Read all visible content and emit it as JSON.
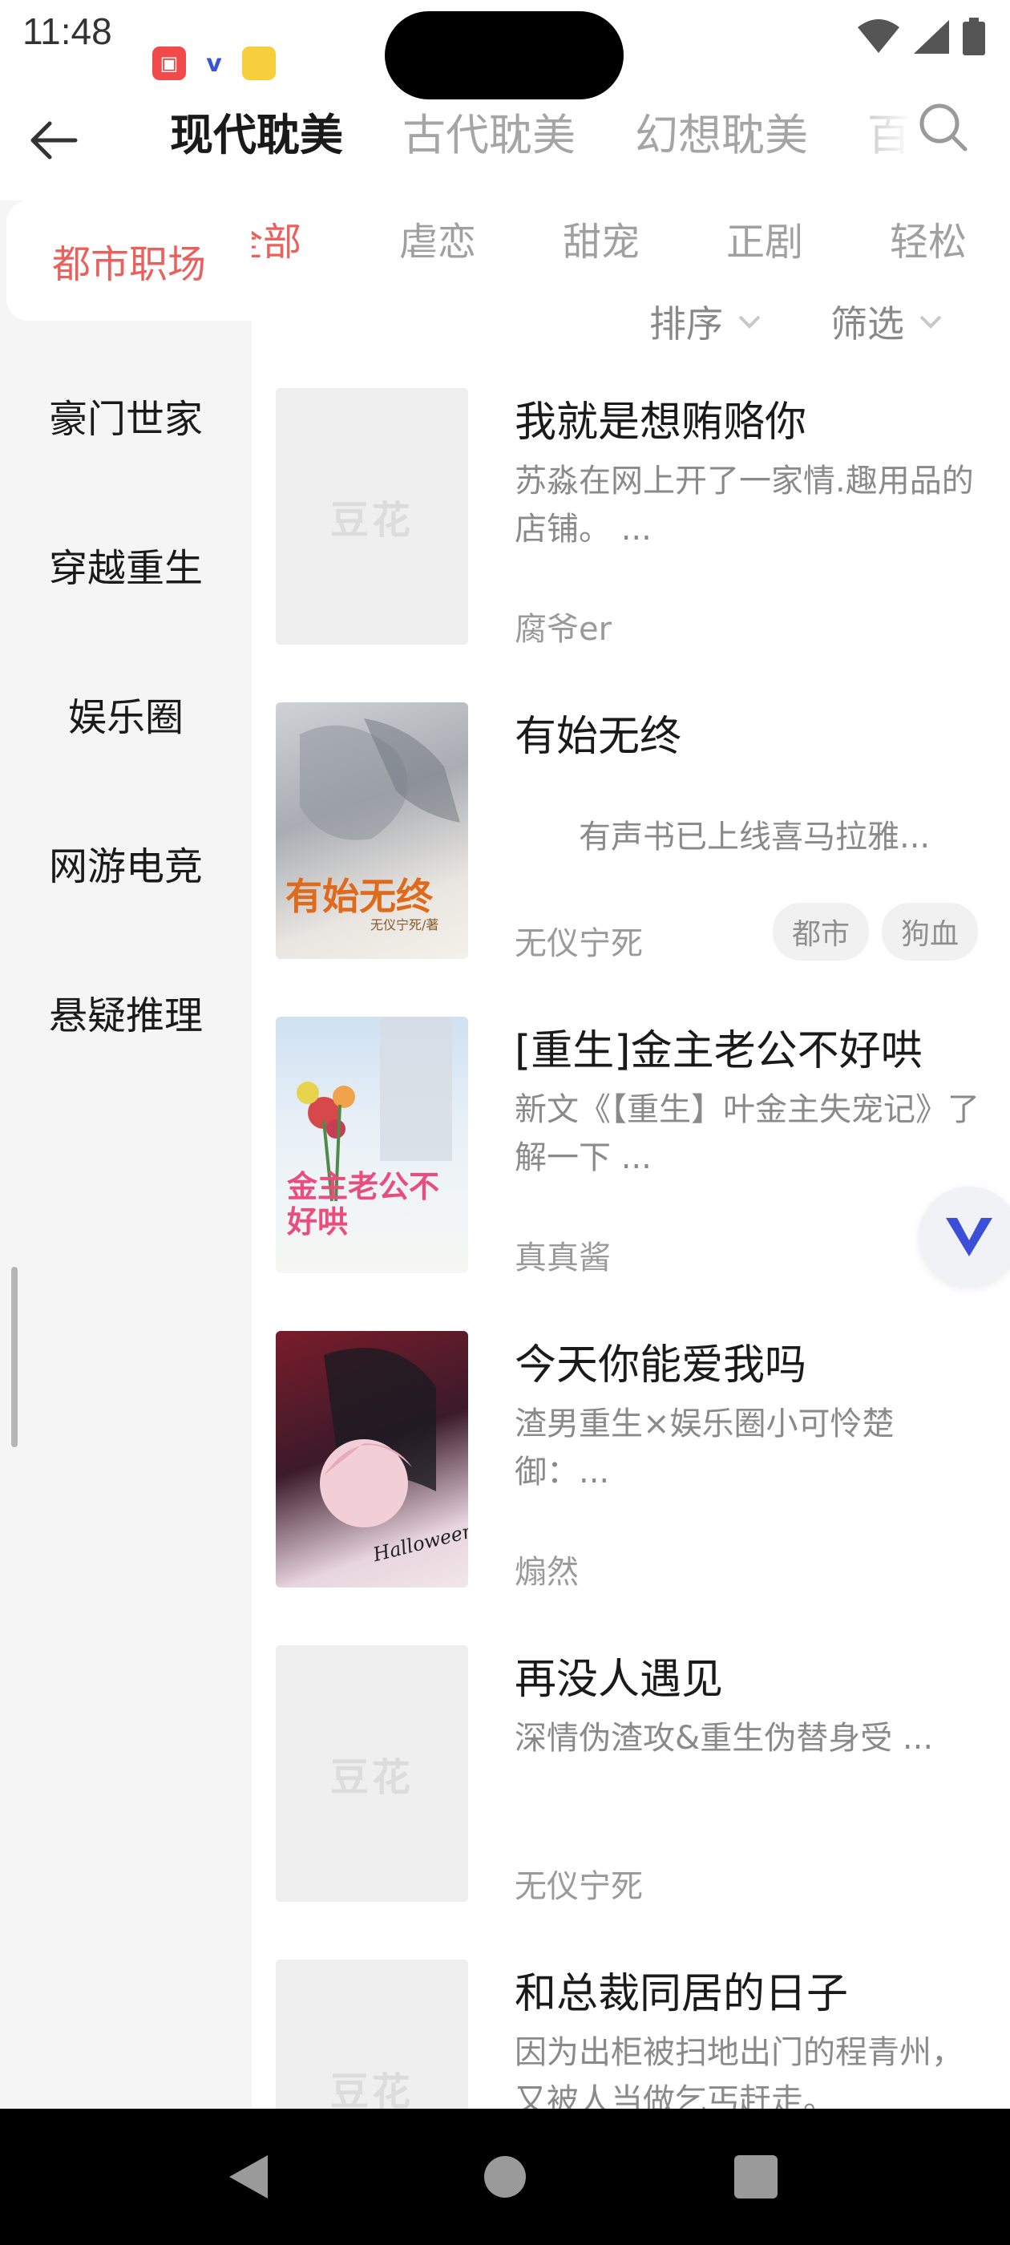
{
  "status_bar": {
    "time": "11:48",
    "notification_icons": [
      "app-notification-icon",
      "v-notification-icon",
      "folder-notification-icon"
    ],
    "system_icons": [
      "wifi-icon",
      "signal-icon",
      "battery-icon"
    ]
  },
  "header": {
    "tabs": [
      {
        "label": "现代耽美",
        "active": true
      },
      {
        "label": "古代耽美",
        "active": false
      },
      {
        "label": "幻想耽美",
        "active": false
      },
      {
        "label": "百",
        "active": false
      }
    ]
  },
  "sidebar": {
    "items": [
      {
        "label": "都市职场",
        "active": true
      },
      {
        "label": "豪门世家",
        "active": false
      },
      {
        "label": "穿越重生",
        "active": false
      },
      {
        "label": "娱乐圈",
        "active": false
      },
      {
        "label": "网游电竞",
        "active": false
      },
      {
        "label": "悬疑推理",
        "active": false
      }
    ]
  },
  "subtabs": [
    {
      "label": "全部",
      "active": true
    },
    {
      "label": "虐恋",
      "active": false
    },
    {
      "label": "甜宠",
      "active": false
    },
    {
      "label": "正剧",
      "active": false
    },
    {
      "label": "轻松",
      "active": false
    }
  ],
  "sort": {
    "sort_label": "排序",
    "filter_label": "筛选"
  },
  "books": [
    {
      "title": "我就是想贿赂你",
      "desc": "苏淼在网上开了一家情.趣用品的店铺。 ...",
      "author": "腐爷er",
      "cover": "placeholder",
      "placeholder_text": "豆花",
      "tags": []
    },
    {
      "title": "有始无终",
      "desc": "　　有声书已上线喜马拉雅...",
      "author": "无仪宁死",
      "cover": "art",
      "cover_text": "有始无终",
      "cover_sub": "无仪宁死/著",
      "tags": [
        "都市",
        "狗血"
      ]
    },
    {
      "title": "[重生]金主老公不好哄",
      "desc": "新文《【重生】叶金主失宠记》了解一下 ...",
      "author": "真真酱",
      "cover": "art",
      "cover_text": "金主老公不好哄",
      "tags": []
    },
    {
      "title": "今天你能爱我吗",
      "desc": "渣男重生×娱乐圈小可怜楚御：...",
      "author": "煽然",
      "cover": "art",
      "cover_text": "Halloween",
      "tags": []
    },
    {
      "title": "再没人遇见",
      "desc": "深情伪渣攻&重生伪替身受 ...",
      "author": "无仪宁死",
      "cover": "placeholder",
      "placeholder_text": "豆花",
      "tags": []
    },
    {
      "title": "和总裁同居的日子",
      "desc": "因为出柜被扫地出门的程青州，又被人当做乞丐赶走。",
      "author": "",
      "cover": "placeholder",
      "placeholder_text": "豆花",
      "tags": []
    }
  ],
  "colors": {
    "accent": "#e9605d",
    "sidebar_bg": "#f5f5f5",
    "inactive_text": "#a5a5a5",
    "tag_bg": "#f1f1f1"
  }
}
